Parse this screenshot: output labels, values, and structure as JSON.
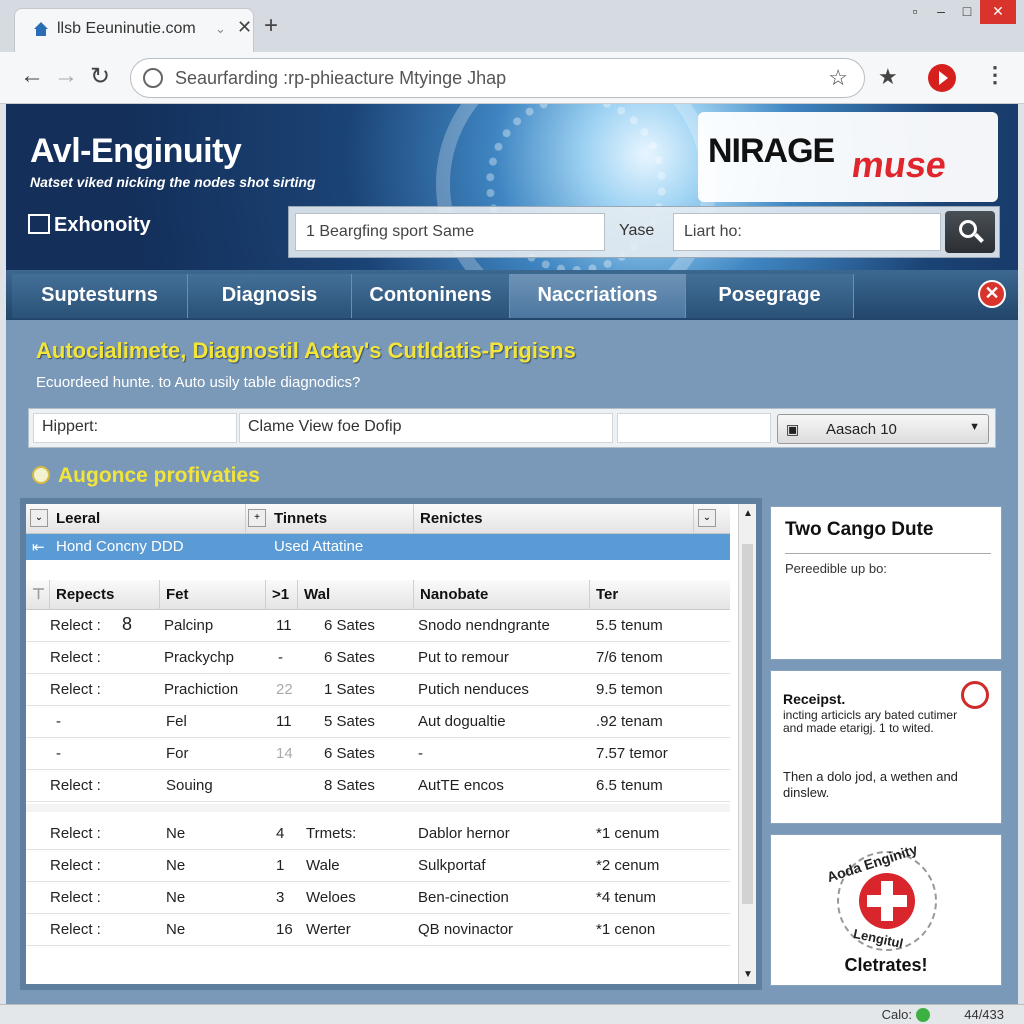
{
  "browser": {
    "tab_title": "llsb Eeuninutie.com",
    "new_tab": "+",
    "address": "Seaurfarding :rp-phieacture Mtyinge Jhap",
    "window_buttons": [
      "▫",
      "–",
      "□",
      "✕"
    ]
  },
  "header": {
    "title": "Avl-Enginuity",
    "tagline": "Natset viked nicking the nodes shot sirting",
    "brand": "Exhonoity",
    "logo_primary": "NIRAGE",
    "logo_secondary": "muse",
    "search_placeholder": "1 Beargfing sport Same",
    "search_label": "Yase",
    "search_second_placeholder": "Liart ho:"
  },
  "nav": {
    "tabs": [
      "Suptesturns",
      "Diagnosis",
      "Contoninens",
      "Naccriations",
      "Posegrage"
    ],
    "active_index": 3
  },
  "page": {
    "headline": "Autocialimete, Diagnostil Actay's Cutldatis-Prigisns",
    "subheadline": "Ecuordeed hunte. to Auto usily table diagnodics?",
    "filter_label": "Hippert:",
    "filter_value": "Clame View foe Dofip",
    "filter_select": "Aasach 10",
    "section_title": "Augonce profivaties"
  },
  "table": {
    "top_headers": [
      "Leeral",
      "Tinnets",
      "Renictes"
    ],
    "selected_row": [
      "Hond Concny DDD",
      "Used Attatine"
    ],
    "headers": [
      "Repects",
      "Fet",
      ">1",
      "Wal",
      "Nanobate",
      "Ter"
    ],
    "group1": [
      [
        "Relect :",
        "8",
        "Palcinp",
        "11",
        "6 Sates",
        "Snodo nendngrante",
        "5.5 tenum"
      ],
      [
        "Relect :",
        "",
        "Prackychp",
        "-",
        "6 Sates",
        "Put to remour",
        "7/6 tenom"
      ],
      [
        "Relect :",
        "",
        "Prachiction",
        "22",
        "1 Sates",
        "Putich nenduces",
        "9.5 temon"
      ],
      [
        "-",
        "",
        "Fel",
        "11",
        "5 Sates",
        "Aut dogualtie",
        ".92 tenam"
      ],
      [
        "-",
        "",
        "For",
        "14",
        "6 Sates",
        "-",
        "7.57 temor"
      ],
      [
        "Relect :",
        "",
        "Souing",
        "",
        "8 Sates",
        "AutTE encos",
        "6.5 tenum"
      ]
    ],
    "group2": [
      [
        "Relect :",
        "Ne",
        "4",
        "Trmets:",
        "Dablor hernor",
        "*1 cenum"
      ],
      [
        "Relect :",
        "Ne",
        "1",
        "Wale",
        "Sulkportaf",
        "*2 cenum"
      ],
      [
        "Relect :",
        "Ne",
        "3",
        "Weloes",
        "Ben-cinection",
        "*4 tenum"
      ],
      [
        "Relect :",
        "Ne",
        "16",
        "Werter",
        "QB novinactor",
        "*1 cenon"
      ]
    ]
  },
  "cards": {
    "card1_title": "Two Cango Dute",
    "card1_text": "Pereedible up bo:",
    "card2_title": "Receipst.",
    "card2_text": "incting articicls ary bated cutimer and made etarigj. 1 to wited.",
    "card2_text2": "Then a dolo jod, a wethen and dinslew.",
    "card3_top": "Aoda Enginity",
    "card3_bottom": "Lengitul",
    "card3_label": "Cletrates!"
  },
  "status": {
    "left": "Calo:",
    "right": "44/433"
  }
}
